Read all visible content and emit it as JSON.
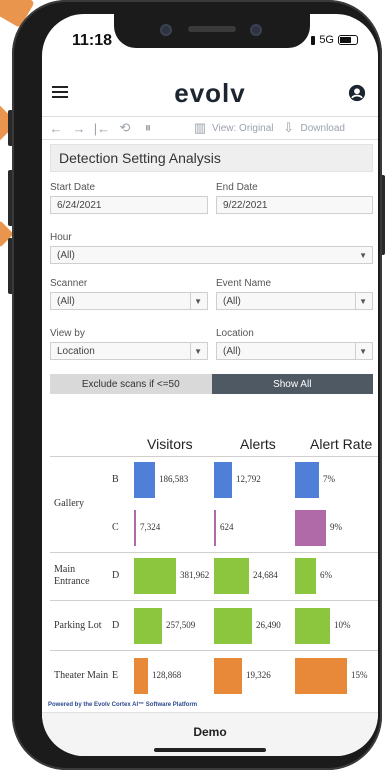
{
  "status": {
    "time": "11:18",
    "network": "5G"
  },
  "header": {
    "logo": "evolv"
  },
  "toolbar": {
    "view_label": "View: Original",
    "download_label": "Download"
  },
  "page": {
    "title": "Detection Setting Analysis"
  },
  "filters": {
    "start_date": {
      "label": "Start Date",
      "value": "6/24/2021"
    },
    "end_date": {
      "label": "End Date",
      "value": "9/22/2021"
    },
    "hour": {
      "label": "Hour",
      "value": "(All)"
    },
    "scanner": {
      "label": "Scanner",
      "value": "(All)"
    },
    "event_name": {
      "label": "Event Name",
      "value": "(All)"
    },
    "view_by": {
      "label": "View by",
      "value": "Location"
    },
    "location": {
      "label": "Location",
      "value": "(All)"
    }
  },
  "segmented": {
    "exclude_label": "Exclude scans if <=50",
    "show_all_label": "Show All"
  },
  "colors": {
    "blue": "#4f7fd6",
    "purple": "#b06aa8",
    "green": "#8cc63f",
    "orange": "#e8893a"
  },
  "chart_data": {
    "type": "table",
    "columns": [
      "Visitors",
      "Alerts",
      "Alert Rate"
    ],
    "rows": [
      {
        "location": "Gallery",
        "scanner": "B",
        "visitors": 186583,
        "visitors_label": "186,583",
        "alerts": 12792,
        "alerts_label": "12,792",
        "alert_rate": 7,
        "alert_rate_label": "7%",
        "color": "blue"
      },
      {
        "location": "",
        "scanner": "C",
        "visitors": 7324,
        "visitors_label": "7,324",
        "alerts": 624,
        "alerts_label": "624",
        "alert_rate": 9,
        "alert_rate_label": "9%",
        "color": "purple"
      },
      {
        "location": "Main Entrance",
        "scanner": "D",
        "visitors": 381962,
        "visitors_label": "381,962",
        "alerts": 24684,
        "alerts_label": "24,684",
        "alert_rate": 6,
        "alert_rate_label": "6%",
        "color": "green"
      },
      {
        "location": "Parking Lot",
        "scanner": "D",
        "visitors": 257509,
        "visitors_label": "257,509",
        "alerts": 26490,
        "alerts_label": "26,490",
        "alert_rate": 10,
        "alert_rate_label": "10%",
        "color": "green"
      },
      {
        "location": "Theater Main",
        "scanner": "E",
        "visitors": 128868,
        "visitors_label": "128,868",
        "alerts": 19326,
        "alerts_label": "19,326",
        "alert_rate": 15,
        "alert_rate_label": "15%",
        "color": "orange"
      }
    ]
  },
  "footer": {
    "powered_by": "Powered by the Evolv Cortex AI™ Software Platform",
    "bottom_label": "Demo"
  }
}
